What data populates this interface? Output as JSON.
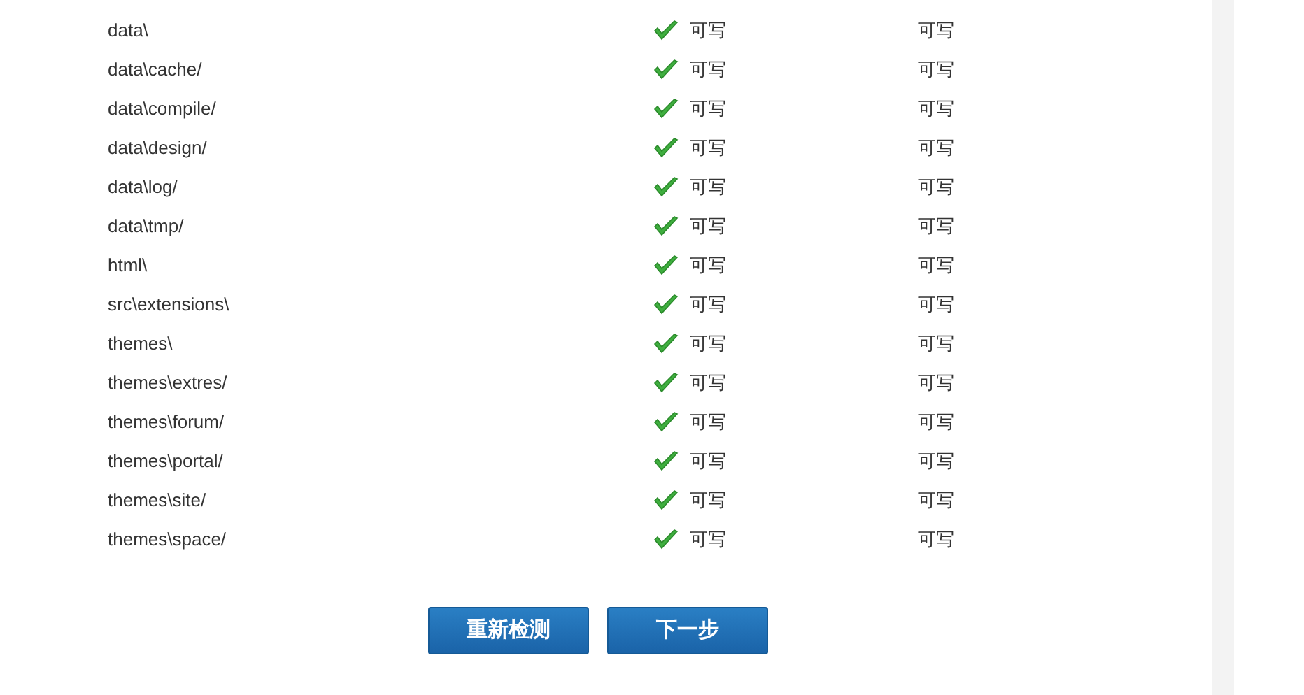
{
  "rows": [
    {
      "path": "data\\",
      "ok": true,
      "current": "可写",
      "required": "可写"
    },
    {
      "path": "data\\cache/",
      "ok": true,
      "current": "可写",
      "required": "可写"
    },
    {
      "path": "data\\compile/",
      "ok": true,
      "current": "可写",
      "required": "可写"
    },
    {
      "path": "data\\design/",
      "ok": true,
      "current": "可写",
      "required": "可写"
    },
    {
      "path": "data\\log/",
      "ok": true,
      "current": "可写",
      "required": "可写"
    },
    {
      "path": "data\\tmp/",
      "ok": true,
      "current": "可写",
      "required": "可写"
    },
    {
      "path": "html\\",
      "ok": true,
      "current": "可写",
      "required": "可写"
    },
    {
      "path": "src\\extensions\\",
      "ok": true,
      "current": "可写",
      "required": "可写"
    },
    {
      "path": "themes\\",
      "ok": true,
      "current": "可写",
      "required": "可写"
    },
    {
      "path": "themes\\extres/",
      "ok": true,
      "current": "可写",
      "required": "可写"
    },
    {
      "path": "themes\\forum/",
      "ok": true,
      "current": "可写",
      "required": "可写"
    },
    {
      "path": "themes\\portal/",
      "ok": true,
      "current": "可写",
      "required": "可写"
    },
    {
      "path": "themes\\site/",
      "ok": true,
      "current": "可写",
      "required": "可写"
    },
    {
      "path": "themes\\space/",
      "ok": true,
      "current": "可写",
      "required": "可写"
    }
  ],
  "buttons": [
    "重新检测",
    "下一步"
  ]
}
